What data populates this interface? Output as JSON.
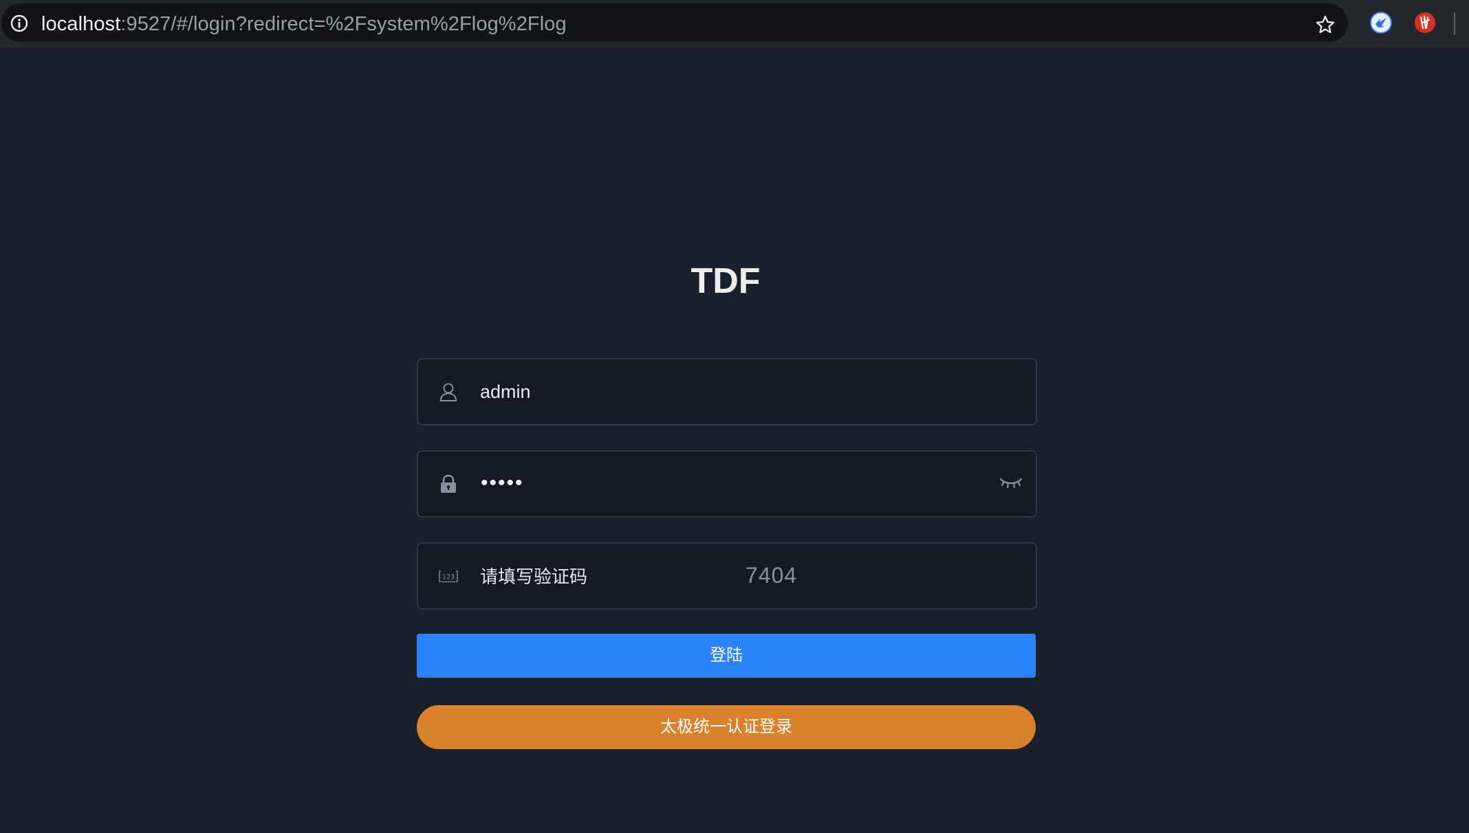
{
  "browser": {
    "url_host": "localhost",
    "url_rest": ":9527/#/login?redirect=%2Fsystem%2Flog%2Flog",
    "icons": [
      "info-icon",
      "star-icon",
      "extension-icon-bird",
      "extension-icon-red"
    ]
  },
  "login": {
    "title": "TDF",
    "username": {
      "icon": "user-icon",
      "value": "admin"
    },
    "password": {
      "icon": "lock-icon",
      "value": "•••••",
      "toggle_icon": "eye-closed-icon"
    },
    "captcha": {
      "icon": "keyboard-number-icon",
      "icon_text": "123",
      "placeholder": "请填写验证码",
      "code": "7404"
    },
    "login_button": "登陆",
    "sso_button": "太极统一认证登录"
  },
  "colors": {
    "background": "#1a202b",
    "primary": "#2a83f6",
    "sso": "#da812c",
    "field_border": "#313845"
  }
}
